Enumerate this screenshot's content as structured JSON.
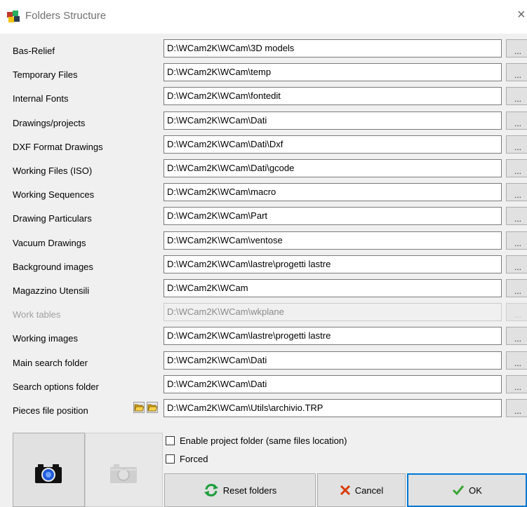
{
  "window": {
    "title": "Folders Structure",
    "close_glyph": "×"
  },
  "rows": [
    {
      "label": "Bas-Relief",
      "path": "D:\\WCam2K\\WCam\\3D models",
      "browse": "...",
      "disabled": false
    },
    {
      "label": "Temporary Files",
      "path": "D:\\WCam2K\\WCam\\temp",
      "browse": "...",
      "disabled": false
    },
    {
      "label": "Internal Fonts",
      "path": "D:\\WCam2K\\WCam\\fontedit",
      "browse": "...",
      "disabled": false
    },
    {
      "label": "Drawings/projects",
      "path": "D:\\WCam2K\\WCam\\Dati",
      "browse": "...",
      "disabled": false
    },
    {
      "label": "DXF Format Drawings",
      "path": "D:\\WCam2K\\WCam\\Dati\\Dxf",
      "browse": "...",
      "disabled": false
    },
    {
      "label": "Working Files (ISO)",
      "path": "D:\\WCam2K\\WCam\\Dati\\gcode",
      "browse": "...",
      "disabled": false
    },
    {
      "label": "Working Sequences",
      "path": "D:\\WCam2K\\WCam\\macro",
      "browse": "...",
      "disabled": false
    },
    {
      "label": "Drawing Particulars",
      "path": "D:\\WCam2K\\WCam\\Part",
      "browse": "...",
      "disabled": false
    },
    {
      "label": "Vacuum Drawings",
      "path": "D:\\WCam2K\\WCam\\ventose",
      "browse": "...",
      "disabled": false
    },
    {
      "label": "Background images",
      "path": "D:\\WCam2K\\WCam\\lastre\\progetti lastre",
      "browse": "...",
      "disabled": false
    },
    {
      "label": "Magazzino Utensili",
      "path": "D:\\WCam2K\\WCam",
      "browse": "...",
      "disabled": false
    },
    {
      "label": "Work tables",
      "path": "D:\\WCam2K\\WCam\\wkplane",
      "browse": "...",
      "disabled": true
    },
    {
      "label": "Working images",
      "path": "D:\\WCam2K\\WCam\\lastre\\progetti lastre",
      "browse": "...",
      "disabled": false
    },
    {
      "label": "Main search folder",
      "path": "D:\\WCam2K\\WCam\\Dati",
      "browse": "...",
      "disabled": false
    },
    {
      "label": "Search options folder",
      "path": "D:\\WCam2K\\WCam\\Dati",
      "browse": "...",
      "disabled": false
    },
    {
      "label": "Pieces file position",
      "path": "D:\\WCam2K\\WCam\\Utils\\archivio.TRP",
      "browse": "...",
      "disabled": false,
      "folder_icons": [
        "open-folder-icon",
        "open-folder-icon"
      ]
    }
  ],
  "options": {
    "enable_project_folder": {
      "label": "Enable project folder (same files location)",
      "checked": false
    },
    "forced": {
      "label": "Forced",
      "checked": false
    }
  },
  "buttons": {
    "camera": {
      "icon": "camera-icon"
    },
    "camera_disabled": {
      "icon": "camera-disabled-icon"
    },
    "reset": {
      "label": "Reset folders",
      "icon": "refresh-icon"
    },
    "cancel": {
      "label": "Cancel",
      "icon": "x-icon"
    },
    "ok": {
      "label": "OK",
      "icon": "checkmark-icon"
    }
  },
  "colors": {
    "accent": "#0078d7",
    "cancel_icon": "#d83b01",
    "ok_icon": "#3aa636",
    "reset_icon": "#1e9e3b"
  }
}
